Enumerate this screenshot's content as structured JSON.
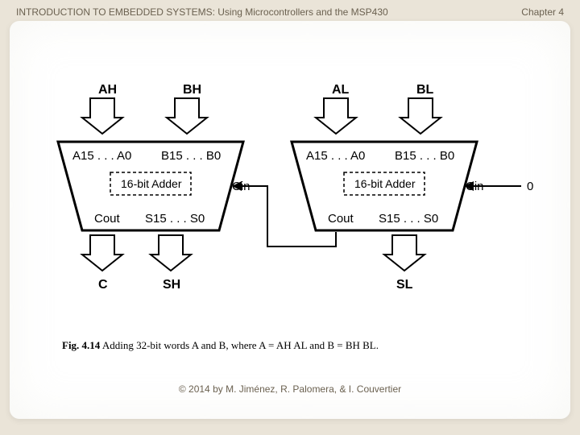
{
  "header": {
    "title": "INTRODUCTION TO EMBEDDED SYSTEMS: Using Microcontrollers and the MSP430",
    "chapter": "Chapter 4"
  },
  "footer": {
    "copyright": "© 2014 by M. Jiménez, R. Palomera, & I. Couvertier"
  },
  "diagram": {
    "top_labels": {
      "ah": "AH",
      "bh": "BH",
      "al": "AL",
      "bl": "BL"
    },
    "ports": {
      "a_hi": "A15 . . . A0",
      "b_hi": "B15 . . . B0",
      "a_lo": "A15 . . . A0",
      "b_lo": "B15 . . . B0",
      "s_hi": "S15 . . . S0",
      "s_lo": "S15 . . . S0",
      "cout": "Cout",
      "cin": "Cin",
      "zero": "0"
    },
    "block_label": "16-bit Adder",
    "bottom_labels": {
      "c": "C",
      "sh": "SH",
      "sl": "SL"
    }
  },
  "caption": {
    "fignum": "Fig. 4.14",
    "text": "  Adding 32-bit words A and B, where A =  AH AL and B =  BH BL."
  }
}
